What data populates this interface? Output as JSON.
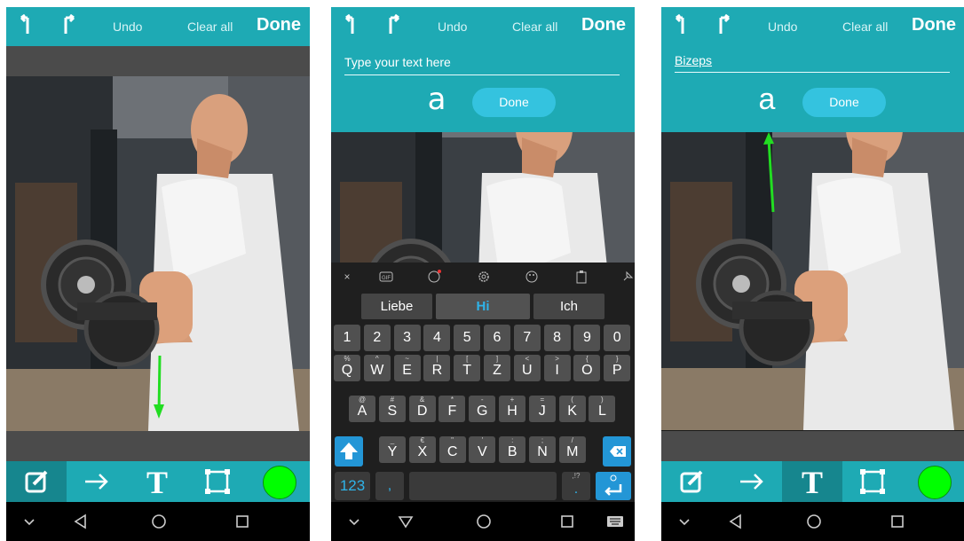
{
  "panels": [
    {
      "topbar": {
        "undo_icon": "undo-arrow-icon",
        "redo_icon": "redo-arrow-icon",
        "undo": "Undo",
        "clear": "Clear all",
        "done": "Done"
      },
      "tools": {
        "active": "pencil",
        "color": "#00ff00"
      }
    },
    {
      "topbar": {
        "undo_icon": "undo-arrow-icon",
        "redo_icon": "redo-arrow-icon",
        "undo": "Undo",
        "clear": "Clear all",
        "done": "Done"
      },
      "text_entry": {
        "placeholder": "Type your text here",
        "value": "",
        "font_glyph": "a",
        "done": "Done"
      },
      "keyboard": {
        "toolbar_icons": [
          "×",
          "GIF",
          "sticker-icon",
          "settings-icon",
          "theme-icon",
          "clipboard-icon",
          "pin-icon"
        ],
        "suggestions": [
          "Liebe",
          "Hi",
          "Ich"
        ],
        "number_row": [
          "1",
          "2",
          "3",
          "4",
          "5",
          "6",
          "7",
          "8",
          "9",
          "0"
        ],
        "row1": [
          {
            "k": "Q",
            "s": "%"
          },
          {
            "k": "W",
            "s": "^"
          },
          {
            "k": "E",
            "s": "~"
          },
          {
            "k": "R",
            "s": "|"
          },
          {
            "k": "T",
            "s": "["
          },
          {
            "k": "Z",
            "s": "]"
          },
          {
            "k": "U",
            "s": "<"
          },
          {
            "k": "I",
            "s": ">"
          },
          {
            "k": "O",
            "s": "{"
          },
          {
            "k": "P",
            "s": "}"
          }
        ],
        "row2": [
          {
            "k": "A",
            "s": "@"
          },
          {
            "k": "S",
            "s": "#"
          },
          {
            "k": "D",
            "s": "&"
          },
          {
            "k": "F",
            "s": "*"
          },
          {
            "k": "G",
            "s": "-"
          },
          {
            "k": "H",
            "s": "+"
          },
          {
            "k": "J",
            "s": "="
          },
          {
            "k": "K",
            "s": "("
          },
          {
            "k": "L",
            "s": ")"
          }
        ],
        "row3": [
          {
            "k": "Y",
            "s": "_"
          },
          {
            "k": "X",
            "s": "€"
          },
          {
            "k": "C",
            "s": "\""
          },
          {
            "k": "V",
            "s": "'"
          },
          {
            "k": "B",
            "s": ":"
          },
          {
            "k": "N",
            "s": ";"
          },
          {
            "k": "M",
            "s": "/"
          }
        ],
        "num_key": "123",
        "comma_key": ",",
        "period_key": ".",
        "period_sub": ",!?"
      }
    },
    {
      "topbar": {
        "undo_icon": "undo-arrow-icon",
        "redo_icon": "redo-arrow-icon",
        "undo": "Undo",
        "clear": "Clear all",
        "done": "Done"
      },
      "text_entry": {
        "value": "Bizeps",
        "font_glyph": "a",
        "done": "Done"
      },
      "tools": {
        "active": "text",
        "color": "#00ff00"
      }
    }
  ],
  "colors": {
    "accent": "#1eaab4",
    "accent_dark": "#16868e",
    "keyboard_bg": "#1f1f1f",
    "suggestion_highlight": "#2fb3e8",
    "drawing_color": "#00ff00"
  },
  "navbar_icons": [
    "chevron-down-icon",
    "back-triangle-icon",
    "home-circle-icon",
    "recents-square-icon"
  ]
}
